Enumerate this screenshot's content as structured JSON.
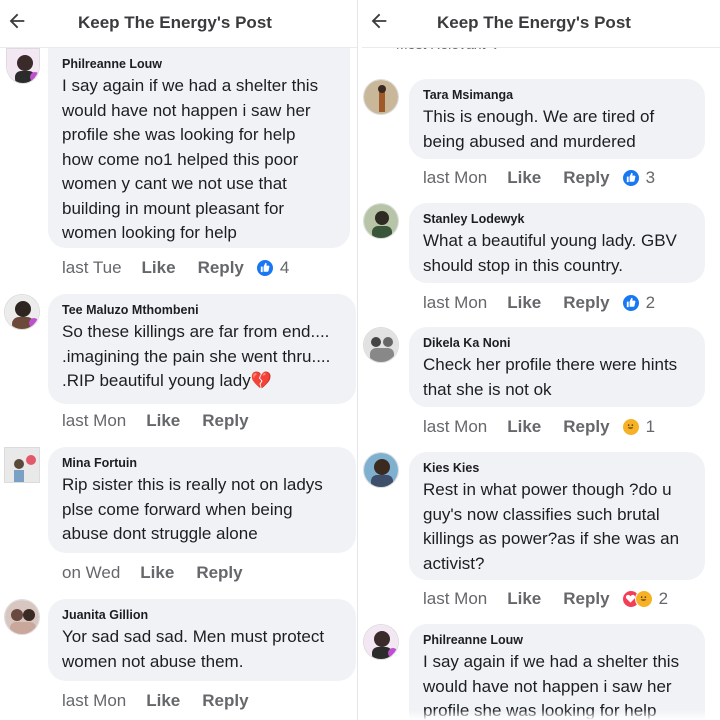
{
  "header": {
    "title": "Keep The Energy's Post"
  },
  "sort_label": "Most Relevant",
  "actions": {
    "like": "Like",
    "reply": "Reply"
  },
  "left": {
    "comments": [
      {
        "author": "Philreanne Louw",
        "text": "I say again if we had a shelter this\nwould have not happen i saw her\nprofile she was looking for help\nhow come no1 helped this poor\nwomen y cant we not use that\nbuilding in mount pleasant for\nwomen looking for help",
        "time": "last Tue",
        "reaction_count": "4",
        "reactions": [
          "like-icon"
        ]
      },
      {
        "author": "Tee Maluzo Mthombeni",
        "text": "So these killings are far from end....\n.imagining the pain she went thru....\n.RIP beautiful young lady",
        "emoji": "💔",
        "time": "last Mon"
      },
      {
        "author": "Mina Fortuin",
        "text": "Rip sister this is really not on ladys\nplse come forward when being\nabuse dont struggle alone",
        "time": "on Wed"
      },
      {
        "author": "Juanita Gillion",
        "text": "Yor sad sad sad. Men must protect\nwomen not abuse them.",
        "time": "last Mon"
      }
    ]
  },
  "right": {
    "comments": [
      {
        "author": "Tara Msimanga",
        "text": "This is enough. We are tired of\nbeing abused and murdered",
        "time": "last Mon",
        "reaction_count": "3",
        "reactions": [
          "like-icon"
        ]
      },
      {
        "author": "Stanley Lodewyk",
        "text": "What a beautiful young lady. GBV\nshould stop in this country.",
        "time": "last Mon",
        "reaction_count": "2",
        "reactions": [
          "like-icon"
        ]
      },
      {
        "author": "Dikela Ka Noni",
        "text": "Check her profile there were hints\nthat she is not ok",
        "time": "last Mon",
        "reaction_count": "1",
        "reactions": [
          "haha-icon"
        ]
      },
      {
        "author": "Kies Kies",
        "text": "Rest in what power though ?do u\nguy's now classifies such brutal\nkillings as power?as if she was an\nactivist?",
        "time": "last Mon",
        "reaction_count": "2",
        "reactions": [
          "love-icon",
          "haha-icon"
        ]
      },
      {
        "author": "Philreanne Louw",
        "text": "I say again if we had a shelter this\nwould have not happen i saw her\nprofile she was looking for help",
        "time": ""
      }
    ]
  },
  "colors": {
    "accent": "#1877f2",
    "bubble": "#f0f2f5",
    "meta": "#65676b",
    "love": "#f33e58",
    "haha": "#f7b125"
  }
}
